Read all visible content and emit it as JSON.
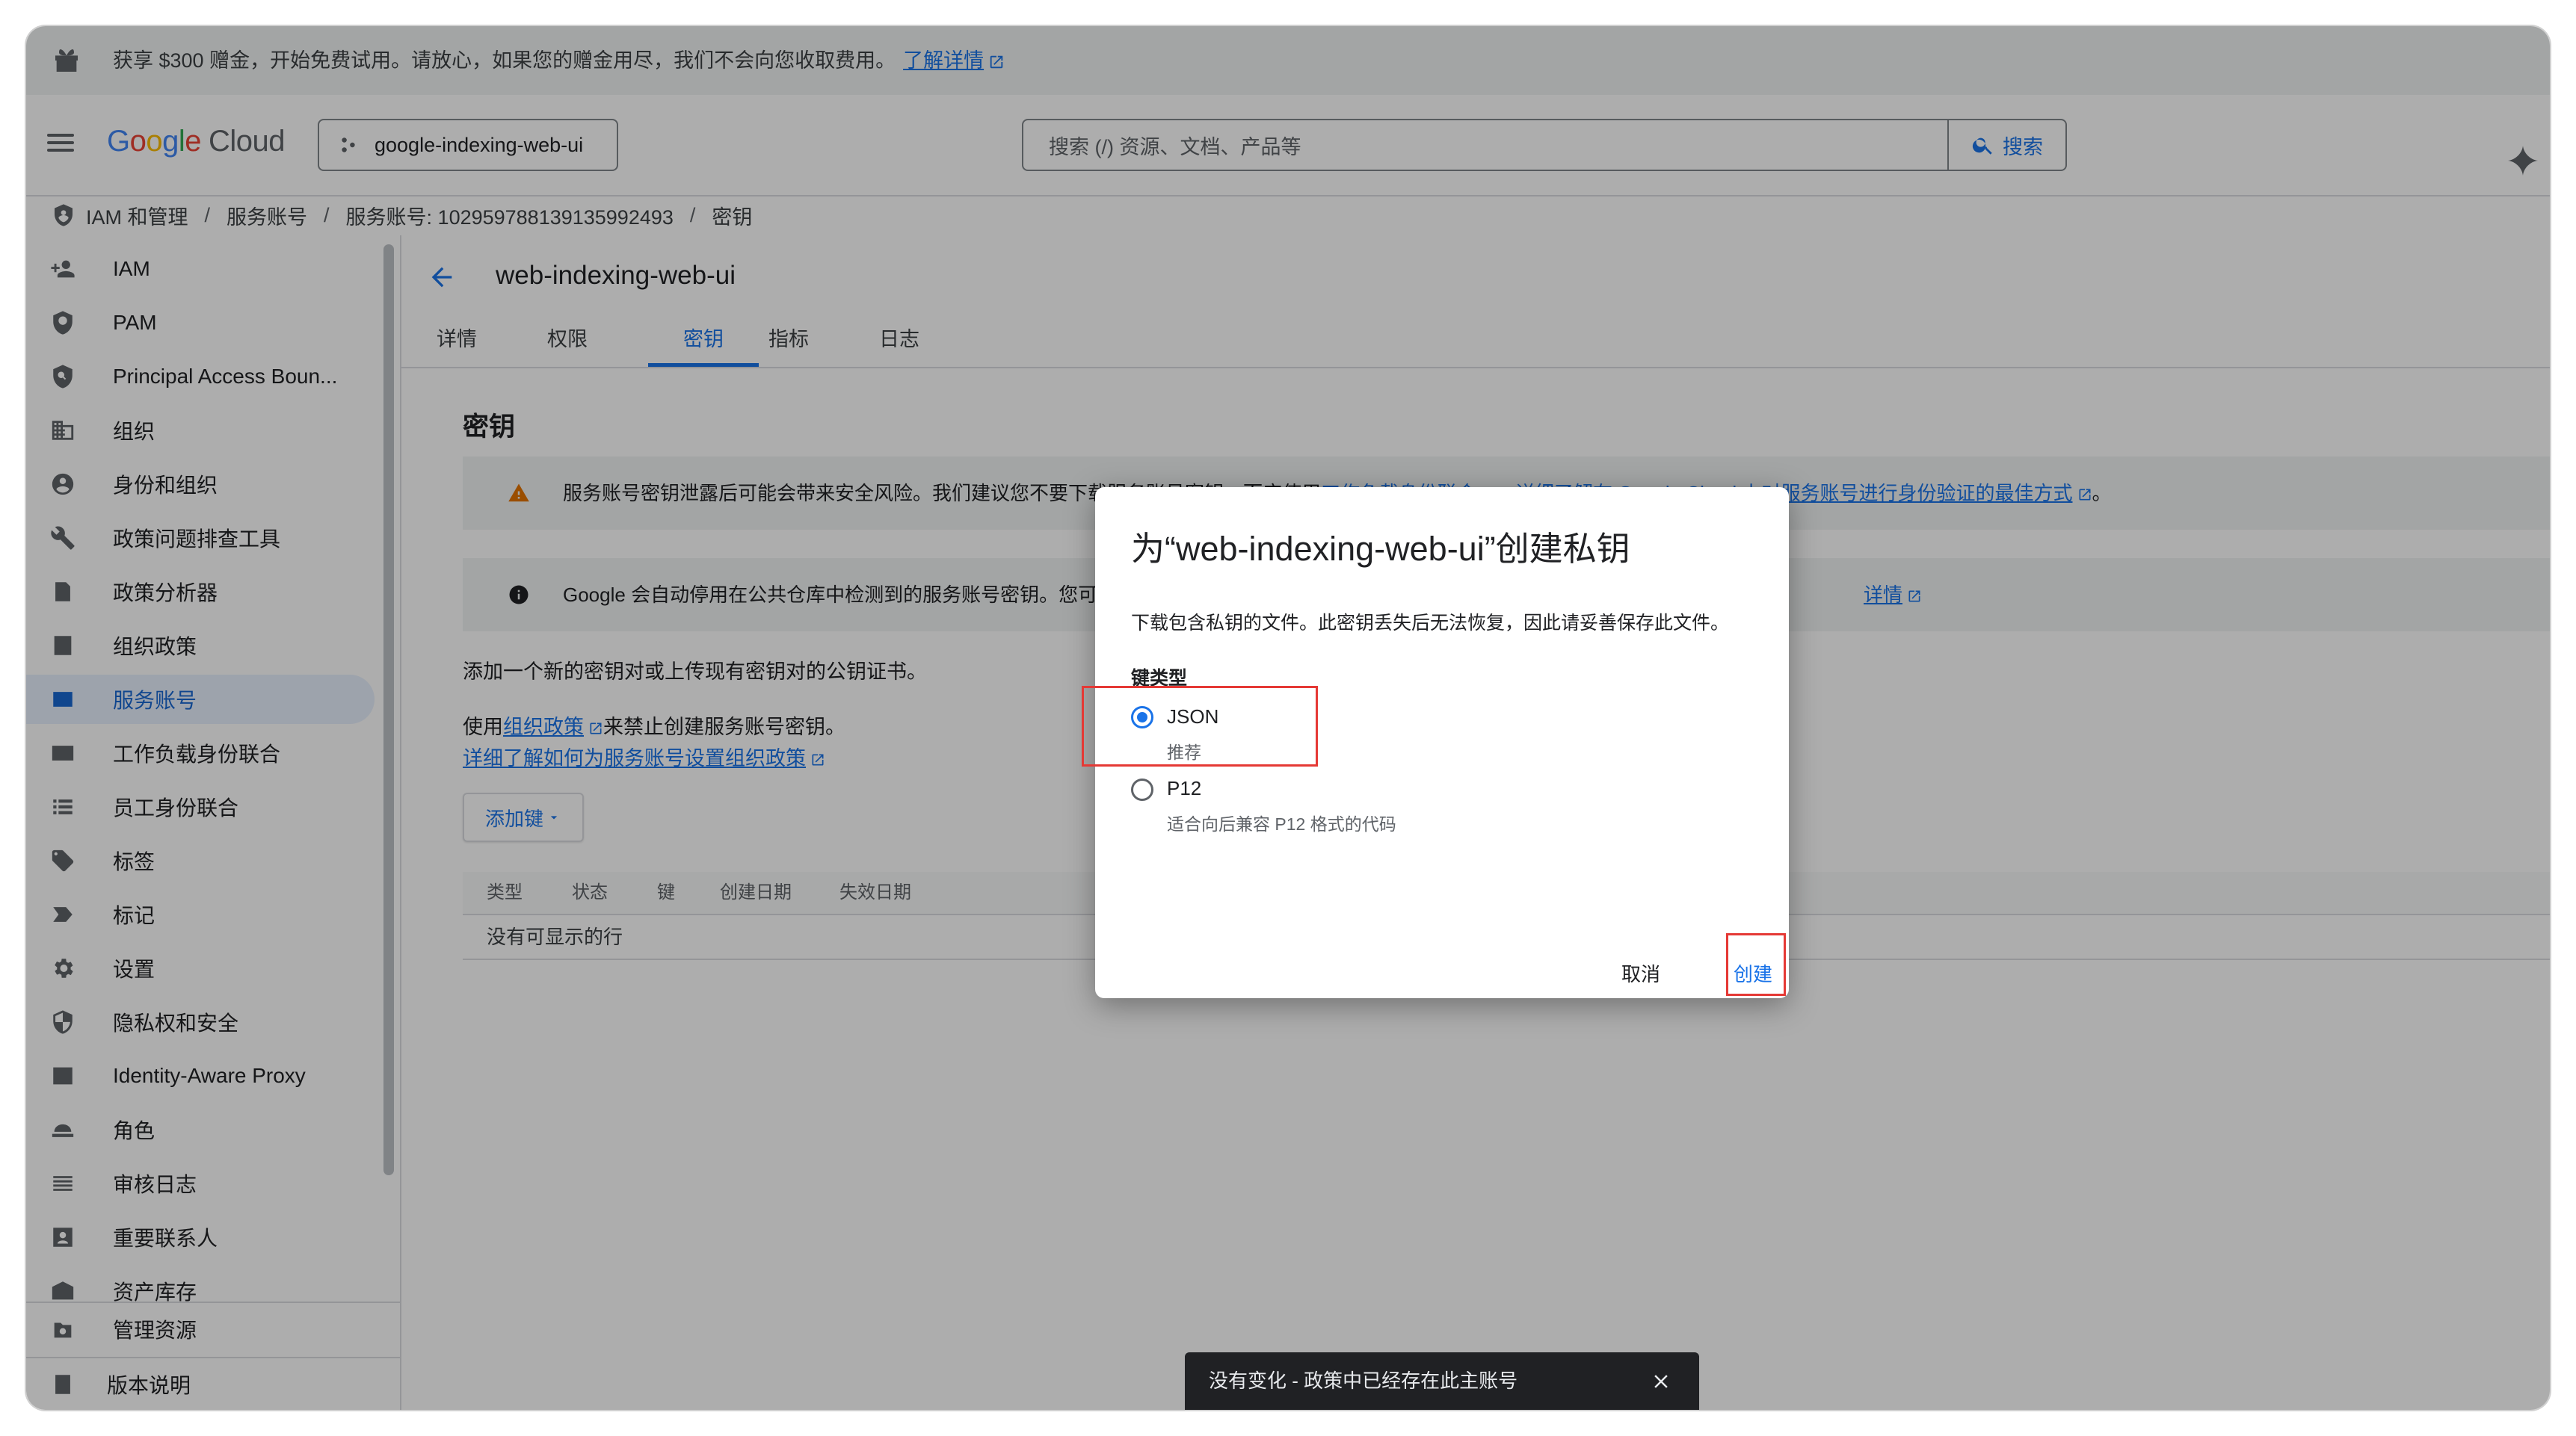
{
  "promo": {
    "text": "获享 $300 赠金，开始免费试用。请放心，如果您的赠金用尽，我们不会向您收取费用。",
    "link": "了解详情"
  },
  "header": {
    "logo_google": [
      "G",
      "o",
      "o",
      "g",
      "l",
      "e"
    ],
    "logo_cloud": "Cloud",
    "project": "google-indexing-web-ui",
    "search_placeholder": "搜索 (/) 资源、文档、产品等",
    "search_button": "搜索"
  },
  "breadcrumb": {
    "items": [
      "IAM 和管理",
      "服务账号",
      "服务账号: 102959788139135992493",
      "密钥"
    ],
    "separator": "/"
  },
  "sidebar": {
    "items": [
      {
        "label": "IAM",
        "icon": "person-add-icon"
      },
      {
        "label": "PAM",
        "icon": "shield-icon"
      },
      {
        "label": "Principal Access Boun...",
        "icon": "policy-icon"
      },
      {
        "label": "组织",
        "icon": "building-icon"
      },
      {
        "label": "身份和组织",
        "icon": "account-circle-icon"
      },
      {
        "label": "政策问题排查工具",
        "icon": "wrench-icon"
      },
      {
        "label": "政策分析器",
        "icon": "analyzer-icon"
      },
      {
        "label": "组织政策",
        "icon": "list-doc-icon"
      },
      {
        "label": "服务账号",
        "icon": "service-account-icon"
      },
      {
        "label": "工作负载身份联合",
        "icon": "id-card-icon"
      },
      {
        "label": "员工身份联合",
        "icon": "list-icon"
      },
      {
        "label": "标签",
        "icon": "tag-icon"
      },
      {
        "label": "标记",
        "icon": "label-icon"
      },
      {
        "label": "设置",
        "icon": "gear-icon"
      },
      {
        "label": "隐私权和安全",
        "icon": "privacy-shield-icon"
      },
      {
        "label": "Identity-Aware Proxy",
        "icon": "proxy-icon"
      },
      {
        "label": "角色",
        "icon": "hat-icon"
      },
      {
        "label": "审核日志",
        "icon": "lines-icon"
      },
      {
        "label": "重要联系人",
        "icon": "contact-icon"
      },
      {
        "label": "资产库存",
        "icon": "inventory-icon"
      }
    ],
    "active_index": 8,
    "bottom": [
      {
        "label": "管理资源",
        "icon": "manage-resources-icon"
      },
      {
        "label": "版本说明",
        "icon": "release-notes-icon"
      }
    ]
  },
  "main": {
    "title": "web-indexing-web-ui",
    "tabs": [
      "详情",
      "权限",
      "密钥",
      "指标",
      "日志"
    ],
    "active_tab": 2,
    "section_title": "密钥",
    "warning": {
      "text": "服务账号密钥泄露后可能会带来安全风险。我们建议您不要下载服务账号密钥，而应使用",
      "link1": "工作负载身份联合",
      "mid": "。",
      "link2": "详细了解在 Google Cloud 上对服务账号进行身份验证的最佳方式",
      "end": "。"
    },
    "info": {
      "text": "Google 会自动停用在公共仓库中检测到的服务账号密钥。您可以",
      "link": "详情"
    },
    "para1": "添加一个新的密钥对或上传现有密钥对的公钥证书。",
    "para2_prefix": "使用",
    "para2_link": "组织政策",
    "para2_suffix": "来禁止创建服务账号密钥。",
    "para3_link": "详细了解如何为服务账号设置组织政策",
    "add_key": "添加键",
    "table_headers": [
      "类型",
      "状态",
      "键",
      "创建日期",
      "失效日期"
    ],
    "empty": "没有可显示的行"
  },
  "dialog": {
    "title": "为“web-indexing-web-ui”创建私钥",
    "description": "下载包含私钥的文件。此密钥丢失后无法恢复，因此请妥善保存此文件。",
    "key_type_label": "键类型",
    "options": [
      {
        "label": "JSON",
        "sub": "推荐",
        "selected": true
      },
      {
        "label": "P12",
        "sub": "适合向后兼容 P12 格式的代码",
        "selected": false
      }
    ],
    "cancel": "取消",
    "create": "创建"
  },
  "snackbar": {
    "text": "没有变化 - 政策中已经存在此主账号"
  },
  "colors": {
    "accent": "#1a73e8",
    "highlight": "#e53935",
    "warning": "#e37400"
  }
}
